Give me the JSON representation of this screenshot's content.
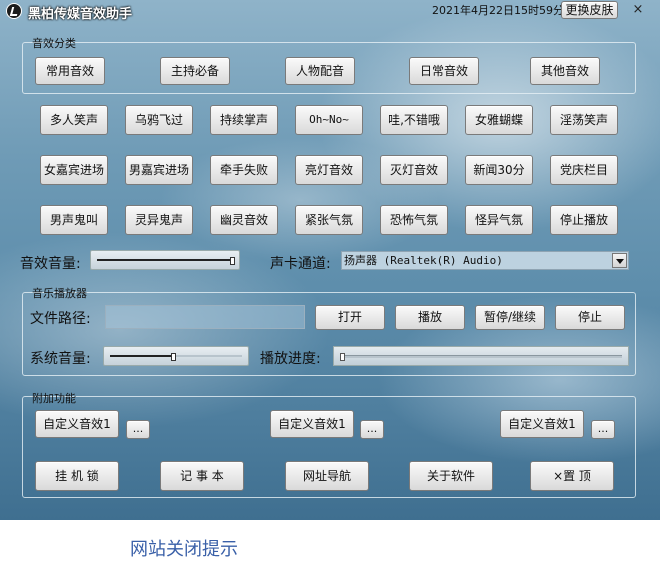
{
  "app": {
    "title": "黑柏传媒音效助手",
    "datetime": "2021年4月22日15时59分",
    "skin_button": "更换皮肤",
    "close_label": "×"
  },
  "effect_category": {
    "label": "音效分类",
    "buttons": [
      "常用音效",
      "主持必备",
      "人物配音",
      "日常音效",
      "其他音效"
    ]
  },
  "effects": {
    "row1": [
      "多人笑声",
      "乌鸦飞过",
      "持续掌声",
      "Oh~No~",
      "哇,不错哦",
      "女雅蝴蝶",
      "淫荡笑声"
    ],
    "row2": [
      "女嘉宾进场",
      "男嘉宾进场",
      "牵手失败",
      "亮灯音效",
      "灭灯音效",
      "新闻30分",
      "党庆栏目"
    ],
    "row3": [
      "男声鬼叫",
      "灵异鬼声",
      "幽灵音效",
      "紧张气氛",
      "恐怖气氛",
      "怪异气氛",
      "停止播放"
    ]
  },
  "volume": {
    "label": "音效音量:",
    "level": 1.0
  },
  "sound_channel": {
    "label": "声卡通道:",
    "selected": "扬声器 (Realtek(R) Audio)"
  },
  "music_player": {
    "label": "音乐播放器",
    "path_label": "文件路径:",
    "path_value": "",
    "open_button": "打开",
    "play_button": "播放",
    "pause_button": "暂停/继续",
    "stop_button": "停止",
    "system_volume_label": "系统音量:",
    "system_volume_level": 0.47,
    "progress_label": "播放进度:",
    "progress_level": 0.0
  },
  "extra": {
    "label": "附加功能",
    "custom_buttons": [
      "自定义音效1",
      "自定义音效1",
      "自定义音效1"
    ],
    "browse_label": "...",
    "tools": [
      "挂 机 锁",
      "记 事 本",
      "网址导航",
      "关于软件",
      "×置  顶"
    ]
  },
  "bottom_text": "网站关闭提示"
}
